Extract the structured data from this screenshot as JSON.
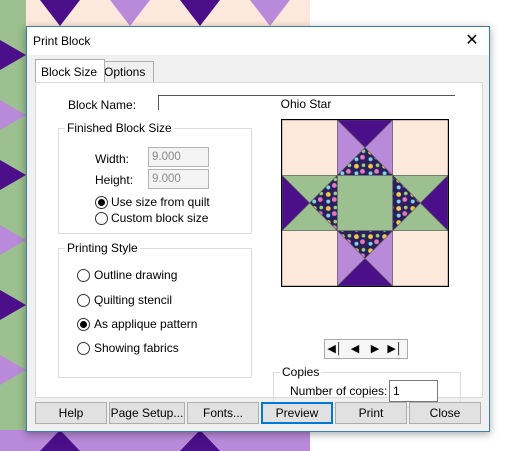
{
  "window": {
    "title": "Print Block",
    "close_label": "✕"
  },
  "tabs": [
    {
      "label": "Block Size",
      "active": true
    },
    {
      "label": "Options",
      "active": false
    }
  ],
  "block_name": {
    "label": "Block Name:",
    "value": "Ohio Star"
  },
  "finished_size": {
    "title": "Finished Block Size",
    "width_label": "Width:",
    "width_value": "9.000",
    "height_label": "Height:",
    "height_value": "9.000",
    "options": [
      {
        "label": "Use size from quilt",
        "selected": true
      },
      {
        "label": "Custom block size",
        "selected": false
      }
    ]
  },
  "printing_style": {
    "title": "Printing Style",
    "options": [
      {
        "label": "Outline drawing",
        "selected": false
      },
      {
        "label": "Quilting stencil",
        "selected": false
      },
      {
        "label": "As applique pattern",
        "selected": true
      },
      {
        "label": "Showing fabrics",
        "selected": false
      }
    ]
  },
  "nav": {
    "first": "◀│",
    "prev": "◀",
    "next": "▶",
    "last": "▶│"
  },
  "copies": {
    "title": "Copies",
    "label": "Number of copies:",
    "value": "1"
  },
  "buttons": {
    "help": "Help",
    "page_setup": "Page Setup...",
    "fonts": "Fonts...",
    "preview": "Preview",
    "print": "Print",
    "close": "Close"
  },
  "colors": {
    "cream": "#fde9dc",
    "purple_dark": "#4b0f8a",
    "purple_light": "#b98ad9",
    "green": "#9cc08f",
    "fabric_dark": "#2a1f5c",
    "dialog_border": "#3c7fb1"
  }
}
